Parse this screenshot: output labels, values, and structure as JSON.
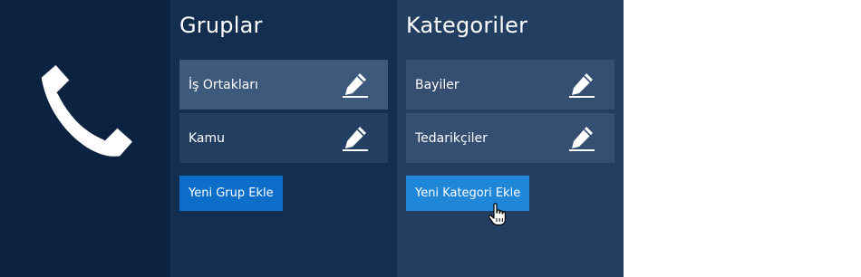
{
  "icon_panel": {
    "icon": "phone-icon"
  },
  "groups": {
    "title": "Gruplar",
    "items": [
      {
        "label": "İş Ortakları",
        "active": true
      },
      {
        "label": "Kamu",
        "active": false
      }
    ],
    "add_button": "Yeni Grup Ekle"
  },
  "categories": {
    "title": "Kategoriler",
    "items": [
      {
        "label": "Bayiler"
      },
      {
        "label": "Tedarikçiler"
      }
    ],
    "add_button": "Yeni Kategori Ekle"
  },
  "colors": {
    "icon_bg": "#0b2241",
    "groups_bg": "#132e4f",
    "categories_bg": "#223f61",
    "item_active": "#3d5a7c",
    "button_primary": "#0c6ec9",
    "button_hover": "#1f86d8"
  }
}
